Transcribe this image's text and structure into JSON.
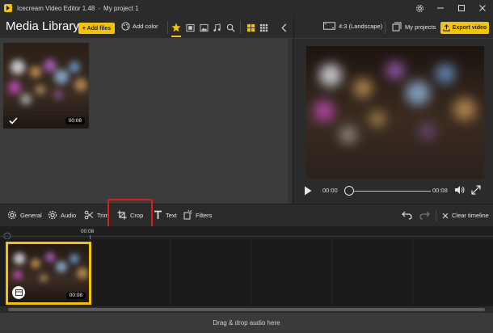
{
  "window": {
    "app_name": "Icecream Video Editor 1.48",
    "separator": "-",
    "project_name": "My project 1"
  },
  "toolbar": {
    "media_library_title": "Media Library",
    "add_files_label": "+ Add files",
    "add_color_label": "Add color",
    "aspect_label": "4:3 (Landscape)",
    "my_projects_label": "My projects",
    "export_label": "Export video"
  },
  "library": {
    "items": [
      {
        "duration": "00:08",
        "selected": true
      }
    ]
  },
  "preview": {
    "current_time": "00:00",
    "total_time": "00:08",
    "progress": 0.0
  },
  "edit_tools": {
    "general": "General",
    "audio": "Audio",
    "trim": "Trim",
    "crop": "Crop",
    "text": "Text",
    "filters": "Filters",
    "clear_timeline": "Clear timeline"
  },
  "timeline": {
    "ruler_label": "00:08",
    "clip_duration": "00:08",
    "audio_drop_text": "Drag & drop audio here"
  },
  "colors": {
    "accent": "#f5c400",
    "highlight_box": "#e11b1b"
  },
  "icons": [
    "app-icon",
    "gear-icon",
    "minimize-icon",
    "maximize-icon",
    "close-icon",
    "palette-icon",
    "star-icon",
    "film-icon",
    "image-icon",
    "music-icon",
    "search-icon",
    "grid-large-icon",
    "grid-small-icon",
    "chevron-left-icon",
    "aspect-ratio-icon",
    "projects-icon",
    "upload-icon",
    "check-icon",
    "play-icon",
    "volume-icon",
    "fullscreen-icon",
    "undo-icon",
    "redo-icon",
    "scissors-icon",
    "crop-icon",
    "text-icon",
    "filters-icon",
    "clear-icon"
  ]
}
